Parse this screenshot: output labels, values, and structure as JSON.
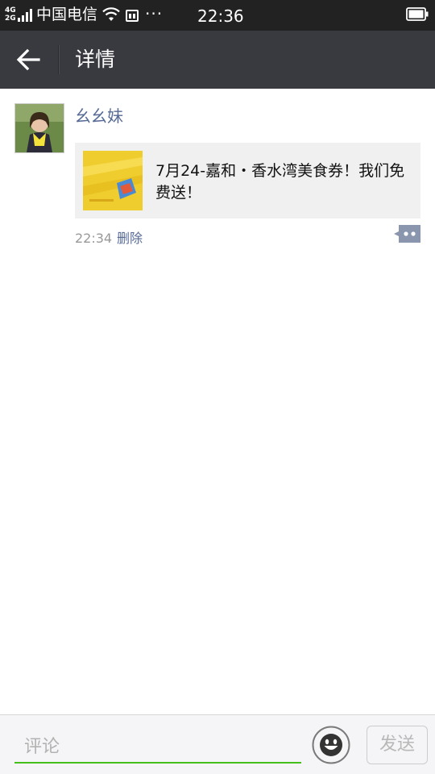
{
  "status_bar": {
    "network_top": "4G",
    "network_bottom": "2G",
    "carrier": "中国电信",
    "more": "···",
    "time": "22:36"
  },
  "header": {
    "title": "详情"
  },
  "moment": {
    "author": "幺幺妹",
    "share_text": "7月24-嘉和・香水湾美食券！我们免费送！",
    "time": "22:34",
    "delete_label": "删除"
  },
  "input_bar": {
    "placeholder": "评论",
    "send_label": "发送"
  },
  "colors": {
    "status_bar_bg": "#222222",
    "header_bg": "#393a3f",
    "link_blue": "#576b95",
    "input_underline": "#45c01a",
    "card_bg": "#f0f0f0"
  },
  "icons": [
    "signal-icon",
    "wifi-icon",
    "sim-icon",
    "battery-icon",
    "back-arrow-icon",
    "comment-more-icon",
    "emoji-icon"
  ]
}
